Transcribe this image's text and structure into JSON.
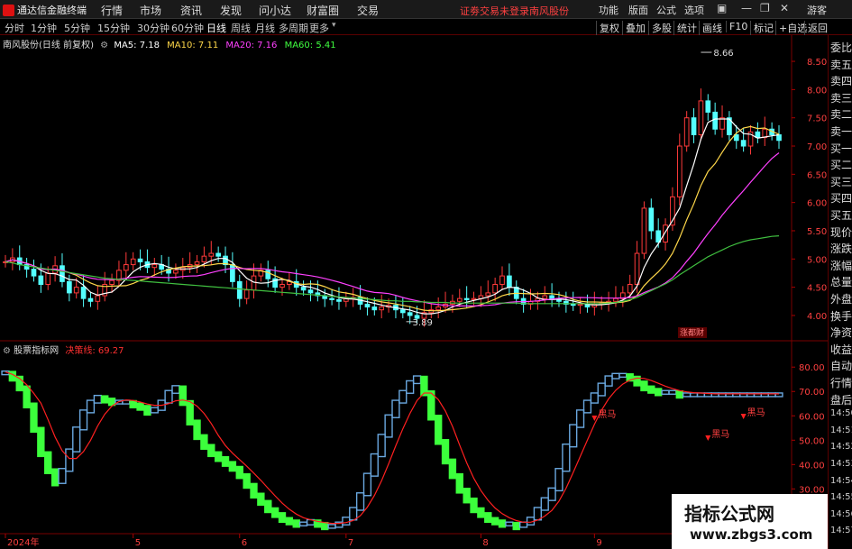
{
  "app": {
    "title": "通达信金融终端",
    "menu": [
      "行情",
      "市场",
      "资讯",
      "发现",
      "问小达",
      "财富圈",
      "交易"
    ],
    "notice": "证劵交易未登录",
    "stock_name": "南风股份",
    "right_menu": [
      "功能",
      "版面",
      "公式",
      "选项"
    ],
    "guest": "游客"
  },
  "toolbar": {
    "periods": [
      "分时",
      "1分钟",
      "5分钟",
      "15分钟",
      "30分钟",
      "60分钟",
      "日线",
      "周线",
      "月线",
      "多周期",
      "更多"
    ],
    "active_period": "日线",
    "right_buttons": [
      "复权",
      "叠加",
      "多股",
      "统计",
      "画线",
      "F10",
      "标记",
      "+自选",
      "返回"
    ]
  },
  "price_panel": {
    "title": "南风股份(日线 前复权)",
    "ma": [
      {
        "label": "MA5: 7.18",
        "color": "#ffffff"
      },
      {
        "label": "MA10: 7.11",
        "color": "#ffd84a"
      },
      {
        "label": "MA20: 7.16",
        "color": "#ff40ff"
      },
      {
        "label": "MA60: 5.41",
        "color": "#40ff40"
      }
    ],
    "high_label": "8.66",
    "low_label": "3.89",
    "event_tag": "涨都财",
    "y_ticks": [
      "8.50",
      "8.00",
      "7.50",
      "7.00",
      "6.50",
      "6.00",
      "5.50",
      "5.00",
      "4.50",
      "4.00"
    ]
  },
  "indicator_panel": {
    "title": "股票指标网",
    "line_label": "决策线: 69.27",
    "y_ticks": [
      "80.00",
      "70.00",
      "60.00",
      "50.00",
      "40.00",
      "30.00"
    ],
    "signals": [
      "黑马",
      "黑马",
      "黑马"
    ]
  },
  "x_axis": {
    "labels": [
      "2024年",
      "5",
      "6",
      "7",
      "8",
      "9",
      "10"
    ]
  },
  "side_panel": {
    "items": [
      "委比",
      "卖五",
      "卖四",
      "卖三",
      "卖二",
      "卖一",
      "买一",
      "买二",
      "买三",
      "买四",
      "买五",
      "现价",
      "涨跌",
      "涨幅",
      "总量",
      "外盘",
      "换手",
      "净资",
      "收益",
      "自动",
      "行情",
      "盘后",
      "14:50",
      "14:51",
      "14:52",
      "14:53",
      "14:54",
      "14:55",
      "14:56",
      "14:57"
    ]
  },
  "watermark": {
    "title": "指标公式网",
    "url": "www.zbgs3.com"
  },
  "chart_data": {
    "type": "candlestick",
    "price_closes": [
      4.95,
      5.02,
      4.9,
      4.82,
      4.7,
      4.55,
      4.75,
      4.88,
      4.6,
      4.4,
      4.5,
      4.3,
      4.25,
      4.35,
      4.55,
      4.62,
      4.8,
      4.9,
      5.0,
      4.95,
      4.85,
      4.9,
      4.82,
      4.75,
      4.8,
      4.85,
      4.9,
      4.95,
      5.05,
      5.1,
      5.05,
      4.9,
      4.6,
      4.3,
      4.45,
      4.7,
      4.8,
      4.65,
      4.5,
      4.55,
      4.6,
      4.5,
      4.45,
      4.4,
      4.35,
      4.3,
      4.28,
      4.25,
      4.3,
      4.32,
      4.2,
      4.15,
      4.1,
      4.15,
      4.18,
      4.1,
      4.05,
      4.0,
      3.95,
      4.05,
      4.1,
      4.15,
      4.2,
      4.25,
      4.3,
      4.28,
      4.3,
      4.35,
      4.4,
      4.55,
      4.7,
      4.5,
      4.3,
      4.2,
      4.25,
      4.3,
      4.35,
      4.3,
      4.25,
      4.2,
      4.18,
      4.2,
      4.15,
      4.2,
      4.22,
      4.25,
      4.3,
      4.4,
      4.55,
      5.1,
      5.9,
      5.5,
      5.3,
      5.6,
      6.1,
      7.0,
      7.5,
      7.2,
      7.8,
      7.6,
      7.3,
      7.5,
      7.2,
      7.1,
      7.0,
      7.25,
      7.15,
      7.3,
      7.2,
      7.1
    ],
    "ma60": [
      4.95,
      4.93,
      4.9,
      4.88,
      4.86,
      4.84,
      4.82,
      4.8,
      4.78,
      4.76,
      4.74,
      4.72,
      4.7,
      4.68,
      4.66,
      4.65,
      4.64,
      4.63,
      4.62,
      4.61,
      4.6,
      4.59,
      4.58,
      4.57,
      4.56,
      4.55,
      4.54,
      4.53,
      4.52,
      4.51,
      4.5,
      4.49,
      4.48,
      4.47,
      4.46,
      4.45,
      4.44,
      4.43,
      4.42,
      4.41,
      4.4,
      4.39,
      4.38,
      4.37,
      4.36,
      4.35,
      4.34,
      4.33,
      4.32,
      4.31,
      4.3,
      4.29,
      4.28,
      4.27,
      4.26,
      4.26,
      4.25,
      4.25,
      4.24,
      4.24,
      4.23,
      4.23,
      4.23,
      4.22,
      4.22,
      4.22,
      4.22,
      4.22,
      4.22,
      4.22,
      4.22,
      4.22,
      4.22,
      4.21,
      4.21,
      4.21,
      4.21,
      4.21,
      4.21,
      4.21,
      4.21,
      4.21,
      4.21,
      4.21,
      4.21,
      4.22,
      4.23,
      4.25,
      4.28,
      4.32,
      4.38,
      4.44,
      4.5,
      4.56,
      4.63,
      4.72,
      4.8,
      4.88,
      4.96,
      5.04,
      5.1,
      5.16,
      5.22,
      5.27,
      5.31,
      5.34,
      5.36,
      5.38,
      5.4,
      5.41
    ],
    "indicator": [
      78,
      76,
      72,
      65,
      55,
      45,
      38,
      33,
      38,
      46,
      55,
      62,
      66,
      68,
      67,
      66,
      66,
      66,
      65,
      64,
      62,
      63,
      66,
      70,
      72,
      66,
      58,
      52,
      48,
      45,
      43,
      41,
      39,
      36,
      32,
      28,
      25,
      22,
      20,
      18,
      17,
      16,
      16,
      17,
      16,
      15,
      15,
      16,
      18,
      22,
      28,
      36,
      44,
      52,
      60,
      66,
      70,
      74,
      76,
      70,
      60,
      50,
      42,
      36,
      30,
      26,
      22,
      20,
      18,
      17,
      16,
      16,
      15,
      16,
      18,
      22,
      26,
      30,
      38,
      48,
      56,
      62,
      66,
      69,
      73,
      76,
      77,
      77,
      76,
      74,
      72,
      71,
      70,
      70,
      70,
      69,
      69,
      69,
      69,
      69,
      69,
      69,
      69,
      69,
      69,
      69,
      69,
      69,
      69,
      69
    ],
    "ylim_price": [
      3.6,
      8.9
    ],
    "ylim_indicator": [
      12,
      86
    ]
  }
}
